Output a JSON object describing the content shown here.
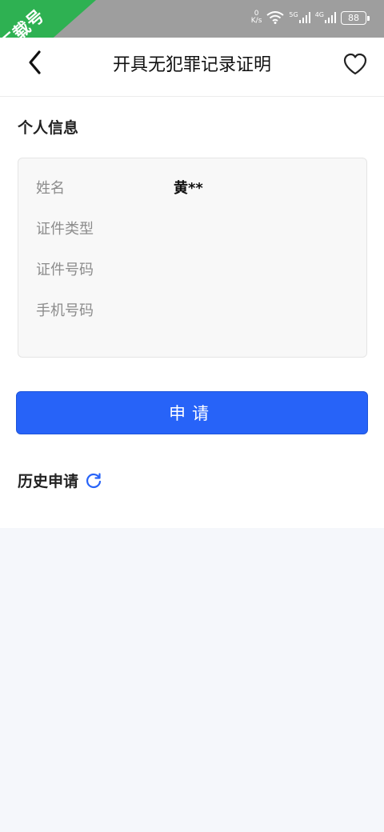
{
  "status_bar": {
    "net_speed_value": "0",
    "net_speed_unit": "K/s",
    "signal_1_label": "5G",
    "signal_2_label": "4G",
    "battery": "88"
  },
  "watermark": {
    "text": "下载号"
  },
  "header": {
    "title": "开具无犯罪记录证明",
    "back_icon": "chevron-left-icon",
    "favorite_icon": "heart-outline-icon"
  },
  "personal_info": {
    "section_title": "个人信息",
    "rows": [
      {
        "label": "姓名",
        "value": "黄**"
      },
      {
        "label": "证件类型",
        "value": ""
      },
      {
        "label": "证件号码",
        "value": ""
      },
      {
        "label": "手机号码",
        "value": ""
      }
    ]
  },
  "apply_button": {
    "label": "申请"
  },
  "history": {
    "section_title": "历史申请",
    "refresh_icon": "refresh-icon"
  },
  "colors": {
    "accent": "#2763f8",
    "status_bar": "#9e9e9e",
    "watermark": "#2eb152"
  }
}
